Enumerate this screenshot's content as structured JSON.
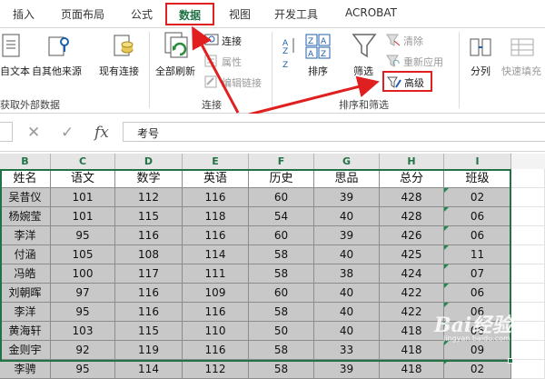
{
  "tabs": [
    {
      "label": "插入"
    },
    {
      "label": "页面布局"
    },
    {
      "label": "公式"
    },
    {
      "label": "数据",
      "active": true
    },
    {
      "label": "视图"
    },
    {
      "label": "开发工具"
    },
    {
      "label": "ACROBAT"
    }
  ],
  "ribbon": {
    "get_external": {
      "from_text": "自文本",
      "from_other": "自其他来源",
      "existing_conn": "现有连接",
      "group_label": "获取外部数据"
    },
    "connections": {
      "refresh_all": "全部刷新",
      "connections": "连接",
      "properties": "属性",
      "edit_links": "编辑链接",
      "group_label": "连接"
    },
    "sort_filter": {
      "sort": "排序",
      "filter": "筛选",
      "clear": "清除",
      "reapply": "重新应用",
      "advanced": "高级",
      "group_label": "排序和筛选"
    },
    "data_tools": {
      "text_to_columns": "分列",
      "flash_fill": "快速填充"
    }
  },
  "formula_bar": {
    "cancel_symbol": "✕",
    "enter_symbol": "✓",
    "fx_symbol": "fx",
    "content": "考号"
  },
  "sheet": {
    "columns": [
      "B",
      "C",
      "D",
      "E",
      "F",
      "G",
      "H",
      "I"
    ],
    "header": [
      "姓名",
      "语文",
      "数学",
      "英语",
      "历史",
      "思品",
      "总分",
      "班级"
    ],
    "rows": [
      [
        "吴昔仪",
        "101",
        "112",
        "116",
        "60",
        "39",
        "428",
        "02"
      ],
      [
        "杨婉莹",
        "101",
        "115",
        "118",
        "54",
        "40",
        "428",
        "06"
      ],
      [
        "李洋",
        "95",
        "116",
        "116",
        "60",
        "39",
        "426",
        "06"
      ],
      [
        "付涵",
        "105",
        "108",
        "114",
        "58",
        "40",
        "425",
        "11"
      ],
      [
        "冯皓",
        "100",
        "117",
        "111",
        "58",
        "38",
        "424",
        "07"
      ],
      [
        "刘朝晖",
        "97",
        "116",
        "109",
        "60",
        "40",
        "422",
        "06"
      ],
      [
        "李洋",
        "95",
        "116",
        "116",
        "58",
        "40",
        "422",
        "06"
      ],
      [
        "黄海轩",
        "103",
        "115",
        "110",
        "50",
        "40",
        "418",
        "06"
      ],
      [
        "金则宇",
        "92",
        "119",
        "116",
        "58",
        "33",
        "418",
        "09"
      ],
      [
        "李骋",
        "95",
        "114",
        "112",
        "58",
        "39",
        "418",
        "02"
      ]
    ]
  },
  "watermark": {
    "main": "Bai经验",
    "sub": "jingyan.baidu.com"
  },
  "colors": {
    "excel_green": "#217346",
    "highlight_red": "#e02020",
    "selection_fill": "#c8c8c8"
  }
}
